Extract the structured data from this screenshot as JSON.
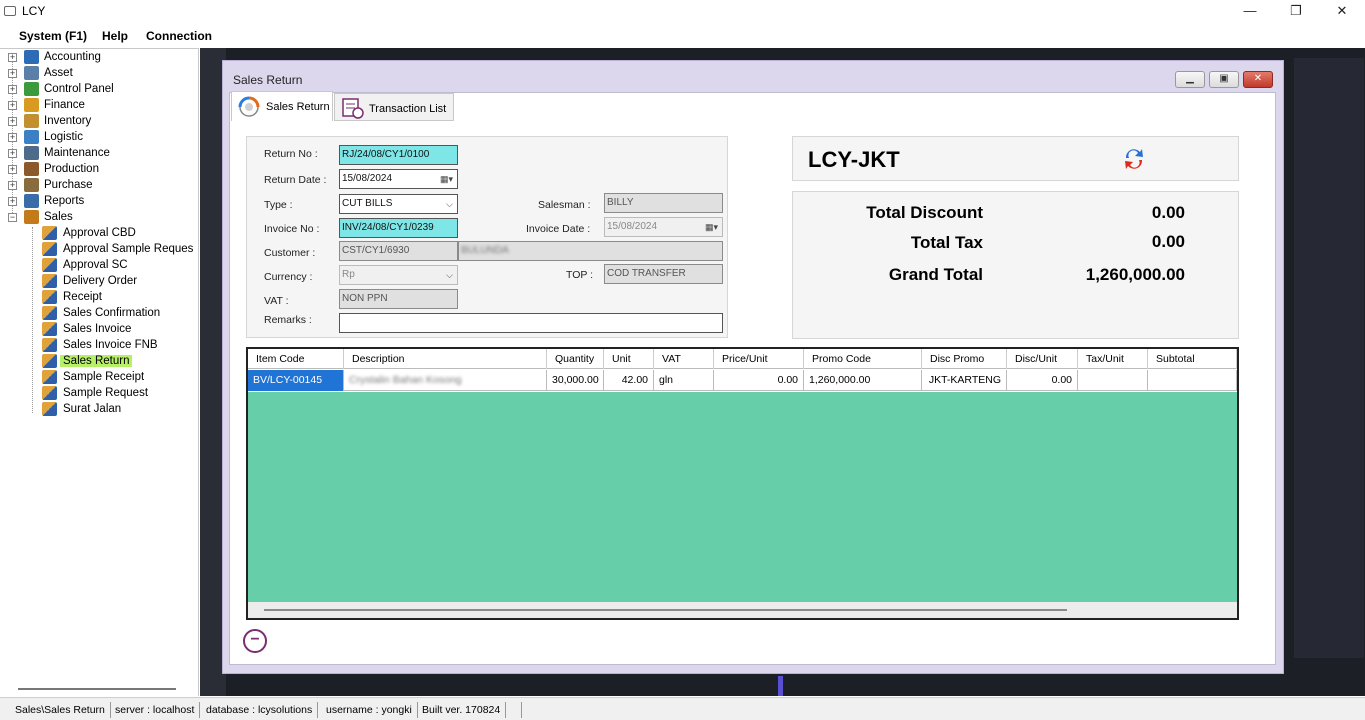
{
  "window": {
    "title": "LCY",
    "minimize": "—",
    "maximize": "❐",
    "close": "✕"
  },
  "menu": [
    "System (F1)",
    "Help",
    "Connection"
  ],
  "tree": {
    "roots": [
      "Accounting",
      "Asset",
      "Control Panel",
      "Finance",
      "Inventory",
      "Logistic",
      "Maintenance",
      "Production",
      "Purchase",
      "Reports",
      "Sales"
    ],
    "sales_children": [
      "Approval CBD",
      "Approval Sample Reques",
      "Approval SC",
      "Delivery Order",
      "Receipt",
      "Sales Confirmation",
      "Sales Invoice",
      "Sales Invoice FNB",
      "Sales Return",
      "Sample Receipt",
      "Sample Request",
      "Surat Jalan"
    ],
    "selected": "Sales Return"
  },
  "inner_window": {
    "title": "Sales Return"
  },
  "tabs": [
    {
      "label": "Sales Return",
      "active": true
    },
    {
      "label": "Transaction List",
      "active": false
    }
  ],
  "form": {
    "return_no_label": "Return No :",
    "return_no": "RJ/24/08/CY1/0100",
    "return_date_label": "Return Date :",
    "return_date": "15/08/2024",
    "type_label": "Type :",
    "type": "CUT BILLS",
    "invoice_no_label": "Invoice No :",
    "invoice_no": "INV/24/08/CY1/0239",
    "customer_label": "Customer :",
    "customer_code": "CST/CY1/6930",
    "customer_name": "BULUNDA",
    "currency_label": "Currency :",
    "currency": "Rp",
    "vat_label": "VAT :",
    "vat": "NON PPN",
    "remarks_label": "Remarks :",
    "remarks": "",
    "salesman_label": "Salesman :",
    "salesman": "BILLY",
    "invoice_date_label": "Invoice Date :",
    "invoice_date": "15/08/2024",
    "top_label": "TOP :",
    "top": "COD TRANSFER"
  },
  "summary": {
    "company": "LCY-JKT",
    "total_discount_label": "Total Discount",
    "total_discount": "0.00",
    "total_tax_label": "Total Tax",
    "total_tax": "0.00",
    "grand_total_label": "Grand Total",
    "grand_total": "1,260,000.00"
  },
  "grid": {
    "columns": [
      "Item Code",
      "Description",
      "Quantity",
      "Unit",
      "VAT",
      "Price/Unit",
      "Promo Code",
      "Disc Promo",
      "Disc/Unit",
      "Tax/Unit",
      "Subtotal"
    ],
    "rows": [
      [
        "BV/LCY-00145",
        "Crystalin Bahan Kosong",
        "30,000.00",
        "42.00",
        "gln",
        "0.00",
        "1,260,000.00",
        "JKT-KARTENG",
        "0.00",
        "",
        ""
      ]
    ]
  },
  "statusbar": [
    "Sales\\Sales Return",
    "server : localhost",
    "database : lcysolutions",
    "username : yongki",
    "Built ver. 170824"
  ],
  "colors": {
    "grid_body": "#66cfaa",
    "selected_cell": "#1f74d6",
    "key_field": "#7ee6e6",
    "tree_selected": "#b5f066",
    "workspace": "#1d1f27"
  }
}
